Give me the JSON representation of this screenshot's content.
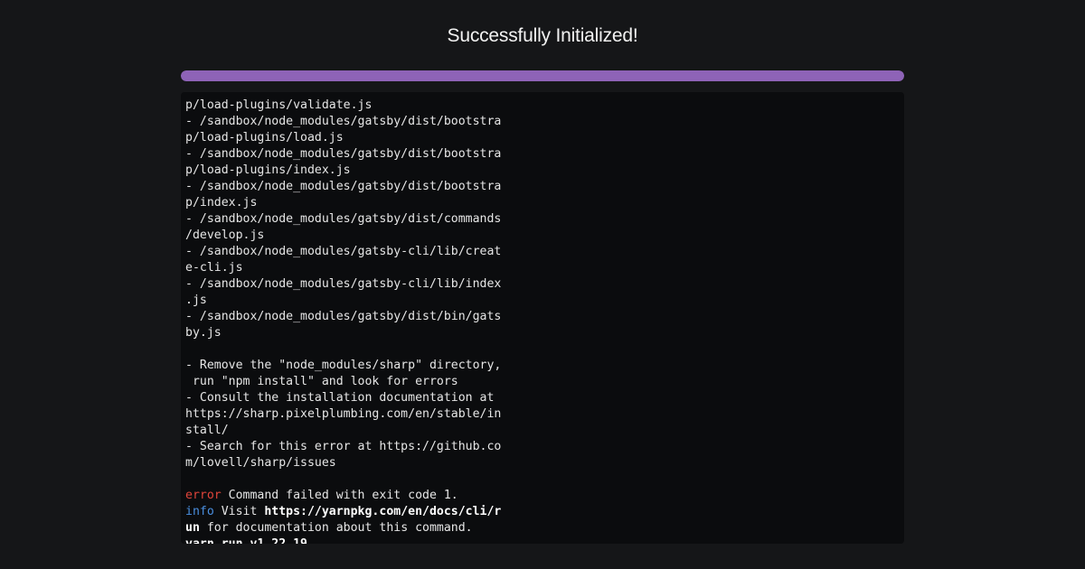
{
  "header": {
    "title": "Successfully Initialized!"
  },
  "progress": {
    "value": 1.0,
    "color": "#8e63b7"
  },
  "terminal": {
    "lines": [
      [
        {
          "text": "p/load-plugins/validate.js",
          "style": "plain"
        }
      ],
      [
        {
          "text": "- /sandbox/node_modules/gatsby/dist/bootstra",
          "style": "plain"
        }
      ],
      [
        {
          "text": "p/load-plugins/load.js",
          "style": "plain"
        }
      ],
      [
        {
          "text": "- /sandbox/node_modules/gatsby/dist/bootstra",
          "style": "plain"
        }
      ],
      [
        {
          "text": "p/load-plugins/index.js",
          "style": "plain"
        }
      ],
      [
        {
          "text": "- /sandbox/node_modules/gatsby/dist/bootstra",
          "style": "plain"
        }
      ],
      [
        {
          "text": "p/index.js",
          "style": "plain"
        }
      ],
      [
        {
          "text": "- /sandbox/node_modules/gatsby/dist/commands",
          "style": "plain"
        }
      ],
      [
        {
          "text": "/develop.js",
          "style": "plain"
        }
      ],
      [
        {
          "text": "- /sandbox/node_modules/gatsby-cli/lib/creat",
          "style": "plain"
        }
      ],
      [
        {
          "text": "e-cli.js",
          "style": "plain"
        }
      ],
      [
        {
          "text": "- /sandbox/node_modules/gatsby-cli/lib/index",
          "style": "plain"
        }
      ],
      [
        {
          "text": ".js",
          "style": "plain"
        }
      ],
      [
        {
          "text": "- /sandbox/node_modules/gatsby/dist/bin/gats",
          "style": "plain"
        }
      ],
      [
        {
          "text": "by.js",
          "style": "plain"
        }
      ],
      [],
      [
        {
          "text": "- Remove the \"node_modules/sharp\" directory,",
          "style": "plain"
        }
      ],
      [
        {
          "text": " run \"npm install\" and look for errors",
          "style": "plain"
        }
      ],
      [
        {
          "text": "- Consult the installation documentation at",
          "style": "plain"
        }
      ],
      [
        {
          "text": "https://sharp.pixelplumbing.com/en/stable/in",
          "style": "plain"
        }
      ],
      [
        {
          "text": "stall/",
          "style": "plain"
        }
      ],
      [
        {
          "text": "- Search for this error at https://github.co",
          "style": "plain"
        }
      ],
      [
        {
          "text": "m/lovell/sharp/issues",
          "style": "plain"
        }
      ],
      [],
      [
        {
          "text": "error",
          "style": "error"
        },
        {
          "text": " Command failed with exit code 1.",
          "style": "plain"
        }
      ],
      [
        {
          "text": "info",
          "style": "info"
        },
        {
          "text": " Visit ",
          "style": "plain"
        },
        {
          "text": "https://yarnpkg.com/en/docs/cli/r",
          "style": "bold"
        }
      ],
      [
        {
          "text": "un",
          "style": "bold"
        },
        {
          "text": " for documentation about this command.",
          "style": "plain"
        }
      ],
      [
        {
          "text": "yarn run v1.22.19",
          "style": "bold"
        }
      ]
    ]
  }
}
